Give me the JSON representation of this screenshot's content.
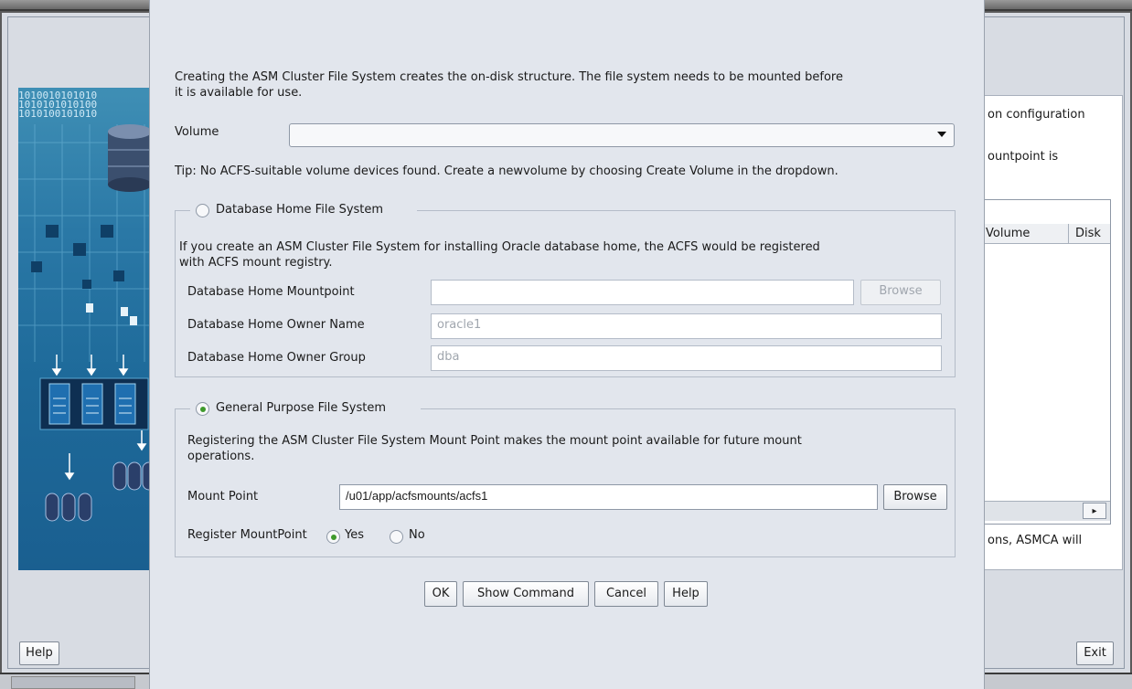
{
  "background_window": {
    "side_graphic_bits": "1010010101010\n1010101010100\n1010100101010",
    "right_panel": {
      "text_top": "on configuration",
      "text_mountpoint": "ountpoint is",
      "column_volume": "Volume",
      "column_disk": "Disk",
      "text_asmca": "ons, ASMCA will",
      "scroll_right_glyph": "▸"
    },
    "help_label": "Help",
    "exit_label": "Exit"
  },
  "dialog": {
    "intro_line1": "Creating the ASM Cluster File System creates the on-disk structure. The file system needs to be mounted before",
    "intro_line2": "it is available for use.",
    "volume_label": "Volume",
    "volume_value": "",
    "tip": "Tip: No ACFS-suitable volume devices found. Create a newvolume by choosing Create Volume in the dropdown.",
    "db_home_group": {
      "title": "Database Home File System",
      "selected": false,
      "desc_line1": "If you create an ASM Cluster File System for installing Oracle database home, the ACFS would be registered",
      "desc_line2": "with ACFS mount registry.",
      "mountpoint_label": "Database Home Mountpoint",
      "mountpoint_value": "",
      "browse_label": "Browse",
      "owner_name_label": "Database Home Owner Name",
      "owner_name_value": "oracle1",
      "owner_group_label": "Database Home Owner Group",
      "owner_group_value": "dba"
    },
    "general_group": {
      "title": "General Purpose File System",
      "selected": true,
      "desc_line1": "Registering the ASM Cluster File System Mount Point makes the mount point available for future mount",
      "desc_line2": "operations.",
      "mount_point_label": "Mount Point",
      "mount_point_value": "/u01/app/acfsmounts/acfs1",
      "browse_label": "Browse",
      "register_label": "Register MountPoint",
      "yes_label": "Yes",
      "no_label": "No",
      "register_selected": "Yes"
    },
    "buttons": {
      "ok": "OK",
      "show_command": "Show Command",
      "cancel": "Cancel",
      "help": "Help"
    }
  },
  "colors": {
    "dialog_bg": "#e2e6ed",
    "radio_selected": "#3f9a2c",
    "graphic_blue": "#1e6a9a"
  }
}
